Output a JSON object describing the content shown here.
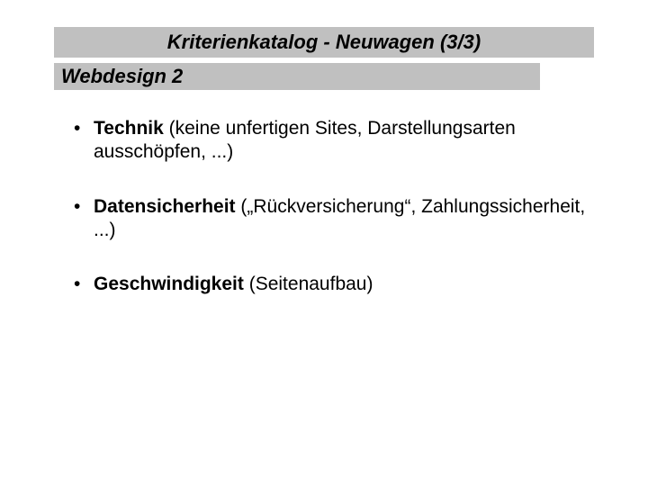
{
  "title": "Kriterienkatalog - Neuwagen (3/3)",
  "subtitle": "Webdesign 2",
  "bullets": [
    {
      "bold": "Technik",
      "rest": " (keine unfertigen Sites, Darstellungsarten ausschöpfen, ...)"
    },
    {
      "bold": "Datensicherheit",
      "rest": " („Rückversicherung“, Zahlungssicherheit, ...)"
    },
    {
      "bold": "Geschwindigkeit",
      "rest": " (Seitenaufbau)"
    }
  ]
}
